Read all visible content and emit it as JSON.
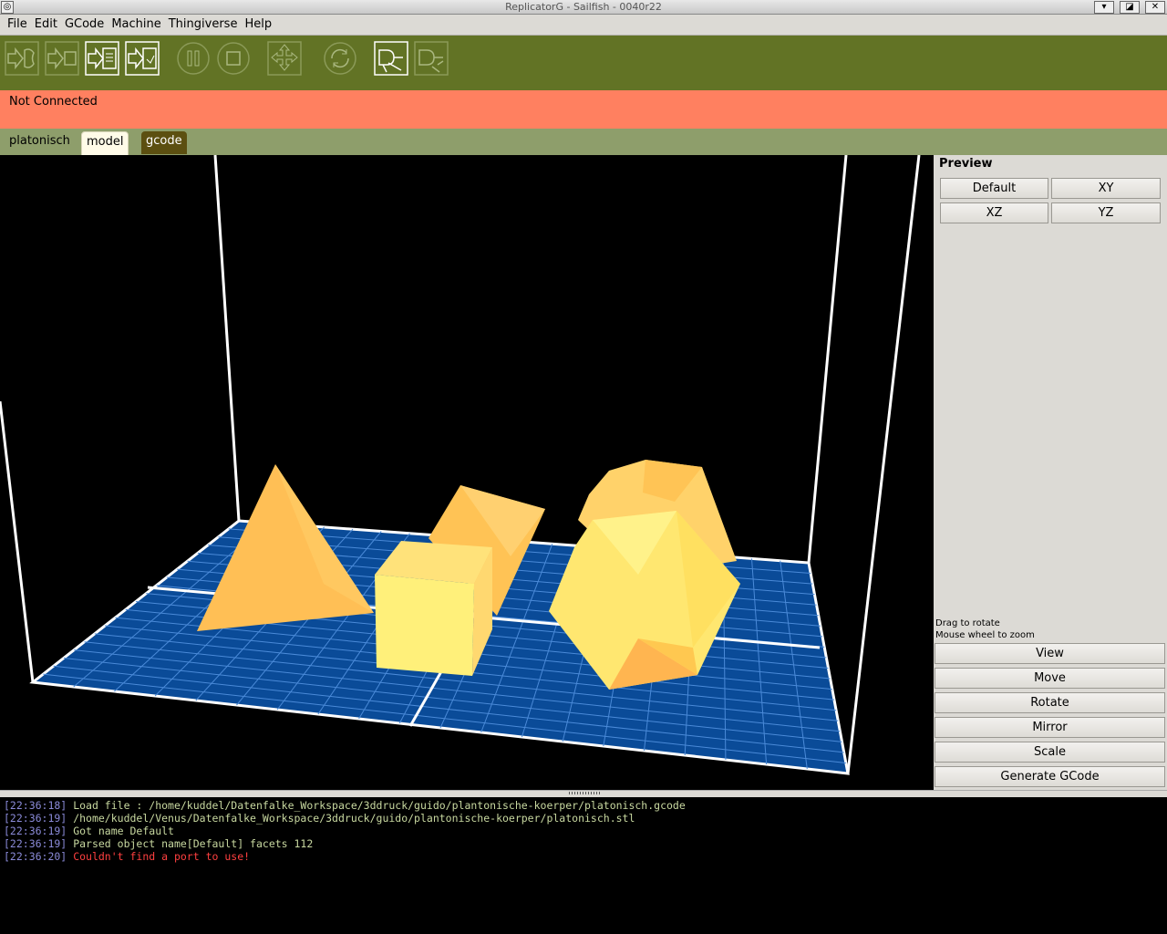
{
  "window": {
    "title": "ReplicatorG - Sailfish - 0040r22"
  },
  "menu": [
    "File",
    "Edit",
    "GCode",
    "Machine",
    "Thingiverse",
    "Help"
  ],
  "toolbar": {
    "buttons": [
      "build-icon",
      "upload-icon",
      "build-to-file-icon",
      "file-to-card-icon",
      "pause-icon",
      "stop-icon",
      "jog-icon",
      "reset-icon",
      "connect-icon",
      "disconnect-icon"
    ]
  },
  "status": {
    "text": "Not Connected",
    "color": "#ff8060"
  },
  "tabs": [
    "platonisch",
    "model",
    "gcode"
  ],
  "preview": {
    "title": "Preview",
    "buttons": [
      "Default",
      "XY",
      "XZ",
      "YZ"
    ],
    "hint1": "Drag to rotate",
    "hint2": "Mouse wheel to zoom",
    "actions": [
      "View",
      "Move",
      "Rotate",
      "Mirror",
      "Scale",
      "Generate GCode"
    ]
  },
  "console": [
    {
      "time": "[22:36:18]",
      "text": "Load file : /home/kuddel/Datenfalke_Workspace/3ddruck/guido/plantonische-koerper/platonisch.gcode",
      "error": false
    },
    {
      "time": "[22:36:19]",
      "text": "/home/kuddel/Venus/Datenfalke_Workspace/3ddruck/guido/plantonische-koerper/platonisch.stl",
      "error": false
    },
    {
      "time": "[22:36:19]",
      "text": "Got name Default",
      "error": false
    },
    {
      "time": "[22:36:19]",
      "text": "Parsed object name[Default] facets 112",
      "error": false
    },
    {
      "time": "[22:36:20]",
      "text": "Couldn't find a port to use!",
      "error": true
    }
  ]
}
